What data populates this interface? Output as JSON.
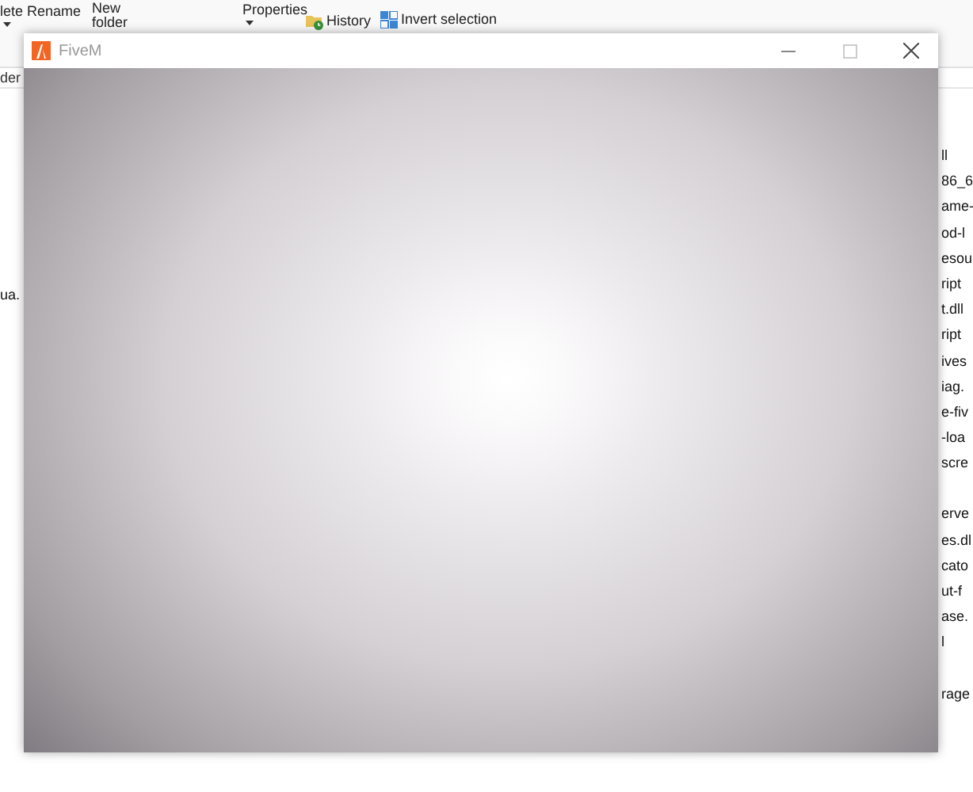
{
  "explorer": {
    "ribbon": [
      {
        "label": "lete",
        "kind": "dropdown"
      },
      {
        "label": "Rename",
        "kind": "plain"
      },
      {
        "label": "New folder",
        "kind": "plain"
      },
      {
        "label": "Properties",
        "kind": "dropdown"
      },
      {
        "label": "History",
        "kind": "history"
      },
      {
        "label": "Invert selection",
        "kind": "select"
      }
    ],
    "address_fragment": "der",
    "left_items": [
      "ua."
    ],
    "file_list": [
      [
        "ll",
        "86_6",
        "ame-",
        "od-l",
        "esou",
        "ript",
        "t.dll",
        "ript",
        "ives",
        "iag.",
        "e-fiv",
        "-loa",
        "scre"
      ],
      [
        "erve",
        "es.dl",
        "cato",
        "ut-f",
        "ase.",
        "l"
      ],
      [
        "rage"
      ]
    ]
  },
  "window": {
    "title": "FiveM"
  }
}
